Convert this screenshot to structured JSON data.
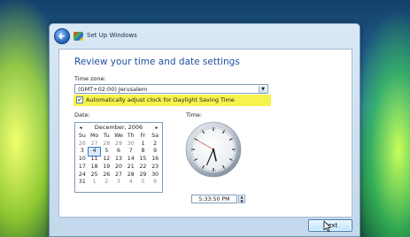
{
  "window": {
    "title": "Set Up Windows"
  },
  "main": {
    "heading": "Review your time and date settings",
    "timezone_label": "Time zone:",
    "timezone_value": "(GMT+02:00) Jerusalem",
    "dst_checked": true,
    "dst_label": "Automatically adjust clock for Daylight Saving Time",
    "date_label": "Date:",
    "time_label": "Time:"
  },
  "calendar": {
    "month_year": "December, 2006",
    "prev_glyph": "◂",
    "next_glyph": "▸",
    "days_of_week": [
      "Su",
      "Mo",
      "Tu",
      "We",
      "Th",
      "Fr",
      "Sa"
    ],
    "weeks": [
      [
        "26",
        "27",
        "28",
        "29",
        "30",
        "1",
        "2"
      ],
      [
        "3",
        "4",
        "5",
        "6",
        "7",
        "8",
        "9"
      ],
      [
        "10",
        "11",
        "12",
        "13",
        "14",
        "15",
        "16"
      ],
      [
        "17",
        "18",
        "19",
        "20",
        "21",
        "22",
        "23"
      ],
      [
        "24",
        "25",
        "26",
        "27",
        "28",
        "29",
        "30"
      ],
      [
        "31",
        "1",
        "2",
        "3",
        "4",
        "5",
        "6"
      ]
    ],
    "selected_day": "4"
  },
  "clock": {
    "hours": 5,
    "minutes": 33,
    "seconds": 50
  },
  "time_field": {
    "value": "5:33:50 PM"
  },
  "buttons": {
    "next_label": "Next"
  },
  "icons": {
    "back": "back-arrow-icon",
    "app": "windows-logo-icon",
    "cursor": "mouse-pointer-icon"
  }
}
